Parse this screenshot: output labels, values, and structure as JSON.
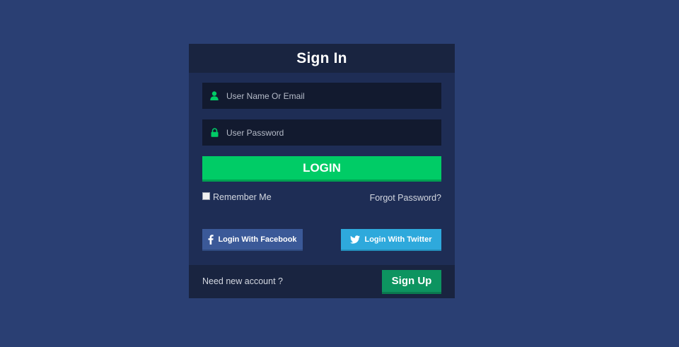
{
  "header": {
    "title": "Sign In"
  },
  "form": {
    "username": {
      "value": "",
      "placeholder": "User Name Or Email",
      "icon": "user-icon"
    },
    "password": {
      "value": "",
      "placeholder": "User Password",
      "icon": "lock-icon"
    },
    "login_label": "LOGIN",
    "remember_label": "Remember Me",
    "remember_checked": false,
    "forgot_label": "Forgot Password?"
  },
  "social": {
    "facebook_label": "Login With Facebook",
    "twitter_label": "Login With Twitter",
    "facebook_icon": "facebook-icon",
    "twitter_icon": "twitter-icon"
  },
  "footer": {
    "prompt": "Need new account ?",
    "signup_label": "Sign Up"
  },
  "colors": {
    "page_background": "#2a3f73",
    "card_background": "#1e2d55",
    "header_background": "#192440",
    "input_background": "#121a2f",
    "accent_green": "#00cc66",
    "signup_green": "#0d9460",
    "facebook_blue": "#3b5998",
    "twitter_blue": "#2ea9dc"
  }
}
